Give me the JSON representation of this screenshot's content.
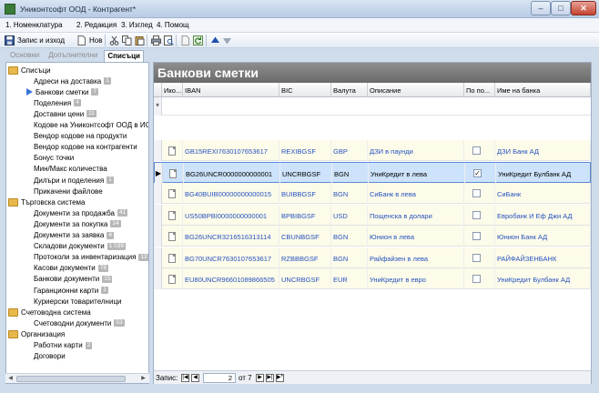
{
  "window": {
    "title": "Униконтсофт ООД - Контрагент*",
    "min": "–",
    "max": "□",
    "close": "✕"
  },
  "menu": [
    "1. Номенклатура",
    "2. Редакция",
    "3. Изглед",
    "4. Помощ"
  ],
  "toolbar": {
    "save_close": "Запис и изход",
    "new": "Нов"
  },
  "left_tabs": [
    "Основни",
    "Допълнителни",
    "Списъци"
  ],
  "tree": [
    {
      "label": "Списъци",
      "type": "folder",
      "indent": 0
    },
    {
      "label": "Адреси на доставка",
      "badge": "1",
      "indent": 1
    },
    {
      "label": "Банкови сметки",
      "badge": "7",
      "indent": 1,
      "selected": true
    },
    {
      "label": "Поделения",
      "badge": "4",
      "indent": 1
    },
    {
      "label": "Доставни цени",
      "badge": "11",
      "indent": 1
    },
    {
      "label": "Кодове на Униконтсофт ООД в ИС",
      "indent": 1
    },
    {
      "label": "Вендор кодове на продукти",
      "indent": 1
    },
    {
      "label": "Вендор кодове на контрагенти",
      "indent": 1
    },
    {
      "label": "Бонус точки",
      "indent": 1
    },
    {
      "label": "Мин/Макс количества",
      "indent": 1
    },
    {
      "label": "Дилъри и поделения",
      "badge": "1",
      "indent": 1
    },
    {
      "label": "Прикачени файлове",
      "indent": 1
    },
    {
      "label": "Търговска система",
      "type": "folder",
      "indent": 0
    },
    {
      "label": "Документи за продажба",
      "badge": "41",
      "indent": 1
    },
    {
      "label": "Документи за покупка",
      "badge": "14",
      "indent": 1
    },
    {
      "label": "Документи за заявка",
      "badge": "4",
      "indent": 1
    },
    {
      "label": "Складови документи",
      "badge": "1 039",
      "indent": 1
    },
    {
      "label": "Протоколи за инвентаризация",
      "badge": "13",
      "indent": 1
    },
    {
      "label": "Касови документи",
      "badge": "78",
      "indent": 1
    },
    {
      "label": "Банкови документи",
      "badge": "15",
      "indent": 1
    },
    {
      "label": "Гаранционни карти",
      "badge": "1",
      "indent": 1
    },
    {
      "label": "Куриерски товарителници",
      "indent": 1
    },
    {
      "label": "Счетоводна система",
      "type": "folder",
      "indent": 0
    },
    {
      "label": "Счетоводни документи",
      "badge": "53",
      "indent": 1
    },
    {
      "label": "Организация",
      "type": "folder",
      "indent": 0
    },
    {
      "label": "Работни карти",
      "badge": "2",
      "indent": 1
    },
    {
      "label": "Договори",
      "indent": 1
    }
  ],
  "panel": {
    "title": "Банкови сметки",
    "columns": [
      "Ико...",
      "IBAN",
      "BIC",
      "Валута",
      "Описание",
      "По по...",
      "Име на банка"
    ],
    "rows": [
      {
        "iban": "GB15REXI7630107653617",
        "bic": "REXIBGSF",
        "currency": "GBP",
        "description": "ДЗИ в паунди",
        "default": "",
        "bank": "ДЗИ Банк АД"
      },
      {
        "iban": "BG26UNCR0000000000001",
        "bic": "UNCRBGSF",
        "currency": "BGN",
        "description": "УниКредит в лева",
        "default": "✓",
        "bank": "УниКредит Булбанк АД",
        "selected": true
      },
      {
        "iban": "BG40BUIB00000000000015",
        "bic": "BUIBBGSF",
        "currency": "BGN",
        "description": "СиБанк в лева",
        "default": "",
        "bank": "СиБанк"
      },
      {
        "iban": "US50BPBI0000000000001",
        "bic": "BPBIBGSF",
        "currency": "USD",
        "description": "Пощенска в долари",
        "default": "",
        "bank": "Евробанк И Еф Джи АД"
      },
      {
        "iban": "BG26UNCR3216516313114",
        "bic": "CBUNBGSF",
        "currency": "BGN",
        "description": "Юнион в лева",
        "default": "",
        "bank": "Юнион Банк АД"
      },
      {
        "iban": "BG70UNCR7630107653617",
        "bic": "RZBBBGSF",
        "currency": "BGN",
        "description": "Райфайзен в лева",
        "default": "",
        "bank": "РАЙФАЙЗЕНБАНК"
      },
      {
        "iban": "EU80UNCR96601089866505",
        "bic": "UNCRBGSF",
        "currency": "EUR",
        "description": "УниКредит в евро",
        "default": "",
        "bank": "УниКредит Булбанк АД"
      }
    ],
    "new_row_marker": "*",
    "current_row_marker": "▶",
    "footer": {
      "label": "Запис:",
      "current": "2",
      "of_label": "от 7"
    }
  }
}
